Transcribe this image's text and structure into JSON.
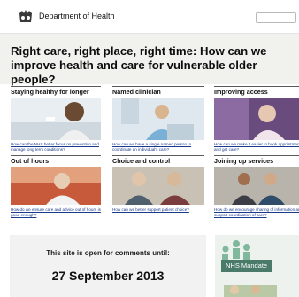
{
  "header": {
    "department": "Department of Health",
    "crest_icon": "royal-crest-icon"
  },
  "headline": "Right care, right place, right time: How can we improve health and care for vulnerable older people?",
  "sections": [
    {
      "title": "Staying healthy for longer",
      "caption": "How can the NHS better focus on prevention and manage long term conditions?"
    },
    {
      "title": "Named clinician",
      "caption": "How can we have a single named person to coordinate an individual's care?"
    },
    {
      "title": "Improving access",
      "caption": "How can we make it easier to book appointments and get care?"
    },
    {
      "title": "Out of hours",
      "caption": "How do we ensure care and advice out of hours is good enough?"
    },
    {
      "title": "Choice and control",
      "caption": "How can we better support patient choice?"
    },
    {
      "title": "Joining up services",
      "caption": "How do we encourage sharing of information and support coordination of care?"
    }
  ],
  "consultation": {
    "open_text": "This site is open for comments until:",
    "date": "27 September 2013"
  },
  "side_panel": {
    "label": "NHS Mandate"
  },
  "colors": {
    "banner_bg": "#f1f1ee",
    "link": "#1a3a8a",
    "panel_bg": "#f2f2f2",
    "mandate_bg": "#4a7a6a"
  }
}
